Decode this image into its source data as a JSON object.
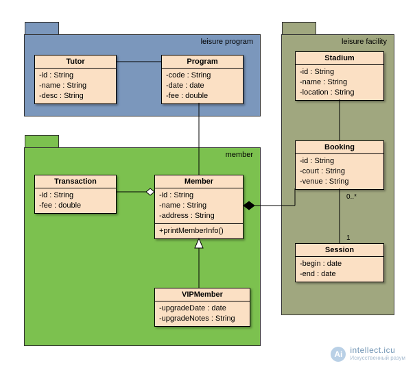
{
  "packages": {
    "leisure_program": {
      "label": "leisure program",
      "fill": "#7b97bc",
      "tab_fill": "#7b97bc"
    },
    "member": {
      "label": "member",
      "fill": "#7cc14f",
      "tab_fill": "#7cc14f"
    },
    "leisure_facility": {
      "label": "leisure facility",
      "fill": "#a0a77f",
      "tab_fill": "#a0a77f"
    }
  },
  "classes": {
    "Tutor": {
      "title": "Tutor",
      "attrs": [
        "-id : String",
        "-name : String",
        "-desc : String"
      ]
    },
    "Program": {
      "title": "Program",
      "attrs": [
        "-code : String",
        "-date : date",
        "-fee : double"
      ]
    },
    "Transaction": {
      "title": "Transaction",
      "attrs": [
        "-id : String",
        "-fee : double"
      ]
    },
    "Member": {
      "title": "Member",
      "attrs": [
        "-id : String",
        "-name : String",
        "-address : String"
      ],
      "ops": [
        "+printMemberInfo()"
      ]
    },
    "VIPMember": {
      "title": "VIPMember",
      "attrs": [
        "-upgradeDate : date",
        "-upgradeNotes : String"
      ]
    },
    "Stadium": {
      "title": "Stadium",
      "attrs": [
        "-id : String",
        "-name : String",
        "-location : String"
      ]
    },
    "Booking": {
      "title": "Booking",
      "attrs": [
        "-id : String",
        "-court : String",
        "-venue : String"
      ]
    },
    "Session": {
      "title": "Session",
      "attrs": [
        "-begin : date",
        "-end : date"
      ]
    }
  },
  "multiplicities": {
    "booking_session_booking": "0..*",
    "booking_session_session": "1"
  },
  "watermark": {
    "letter": "Ai",
    "brand": "intellect.icu",
    "sub": "Искусственный разум"
  },
  "chart_data": {
    "type": "uml_class_diagram",
    "packages": [
      {
        "name": "leisure program",
        "classes": [
          {
            "name": "Tutor",
            "attributes": [
              {
                "name": "id",
                "type": "String",
                "vis": "-"
              },
              {
                "name": "name",
                "type": "String",
                "vis": "-"
              },
              {
                "name": "desc",
                "type": "String",
                "vis": "-"
              }
            ],
            "operations": []
          },
          {
            "name": "Program",
            "attributes": [
              {
                "name": "code",
                "type": "String",
                "vis": "-"
              },
              {
                "name": "date",
                "type": "date",
                "vis": "-"
              },
              {
                "name": "fee",
                "type": "double",
                "vis": "-"
              }
            ],
            "operations": []
          }
        ]
      },
      {
        "name": "member",
        "classes": [
          {
            "name": "Transaction",
            "attributes": [
              {
                "name": "id",
                "type": "String",
                "vis": "-"
              },
              {
                "name": "fee",
                "type": "double",
                "vis": "-"
              }
            ],
            "operations": []
          },
          {
            "name": "Member",
            "attributes": [
              {
                "name": "id",
                "type": "String",
                "vis": "-"
              },
              {
                "name": "name",
                "type": "String",
                "vis": "-"
              },
              {
                "name": "address",
                "type": "String",
                "vis": "-"
              }
            ],
            "operations": [
              {
                "name": "printMemberInfo",
                "vis": "+"
              }
            ]
          },
          {
            "name": "VIPMember",
            "attributes": [
              {
                "name": "upgradeDate",
                "type": "date",
                "vis": "-"
              },
              {
                "name": "upgradeNotes",
                "type": "String",
                "vis": "-"
              }
            ],
            "operations": []
          }
        ]
      },
      {
        "name": "leisure facility",
        "classes": [
          {
            "name": "Stadium",
            "attributes": [
              {
                "name": "id",
                "type": "String",
                "vis": "-"
              },
              {
                "name": "name",
                "type": "String",
                "vis": "-"
              },
              {
                "name": "location",
                "type": "String",
                "vis": "-"
              }
            ],
            "operations": []
          },
          {
            "name": "Booking",
            "attributes": [
              {
                "name": "id",
                "type": "String",
                "vis": "-"
              },
              {
                "name": "court",
                "type": "String",
                "vis": "-"
              },
              {
                "name": "venue",
                "type": "String",
                "vis": "-"
              }
            ],
            "operations": []
          },
          {
            "name": "Session",
            "attributes": [
              {
                "name": "begin",
                "type": "date",
                "vis": "-"
              },
              {
                "name": "end",
                "type": "date",
                "vis": "-"
              }
            ],
            "operations": []
          }
        ]
      }
    ],
    "relationships": [
      {
        "type": "association",
        "from": "Tutor",
        "to": "Program"
      },
      {
        "type": "association",
        "from": "Program",
        "to": "Member"
      },
      {
        "type": "aggregation",
        "whole": "Member",
        "part": "Transaction"
      },
      {
        "type": "generalization",
        "parent": "Member",
        "child": "VIPMember"
      },
      {
        "type": "composition",
        "whole": "Member",
        "part": "Booking"
      },
      {
        "type": "association",
        "from": "Stadium",
        "to": "Booking"
      },
      {
        "type": "association",
        "from": "Booking",
        "to": "Session",
        "multiplicity": {
          "Booking": "0..*",
          "Session": "1"
        }
      }
    ]
  }
}
